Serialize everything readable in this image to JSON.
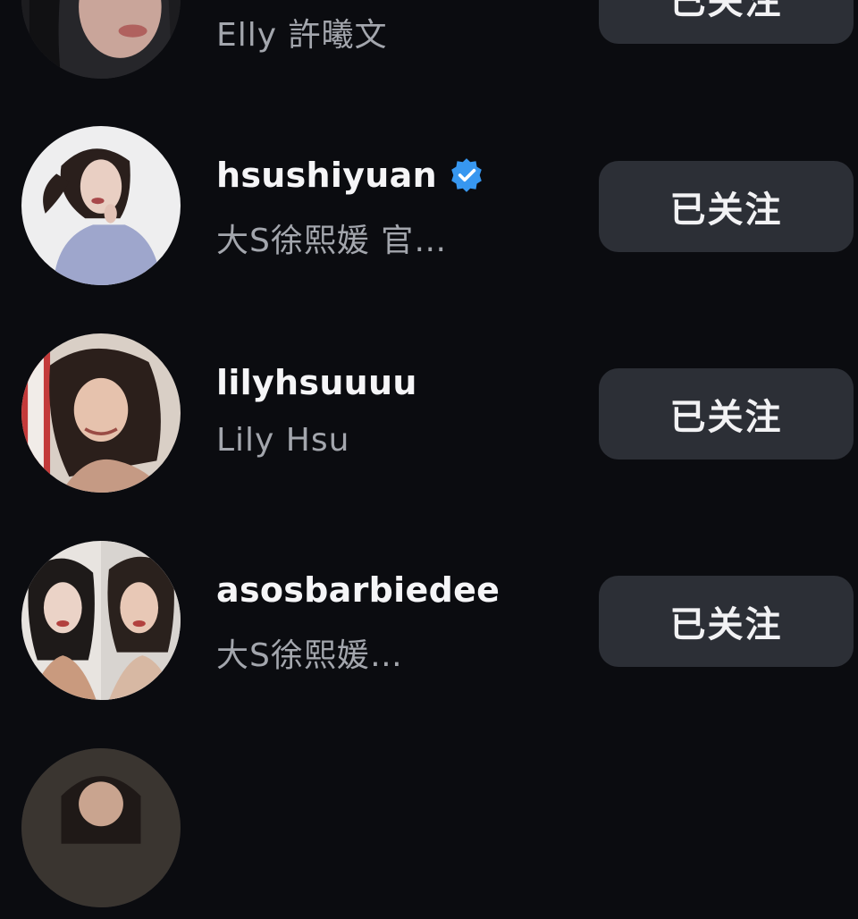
{
  "follow_list": {
    "rows": [
      {
        "username": "",
        "full_name": "Elly 許曦文",
        "button_label": "已关注"
      },
      {
        "username": "hsushiyuan",
        "verified": true,
        "full_name": "大S徐熙媛  官…",
        "button_label": "已关注"
      },
      {
        "username": "lilyhsuuuu",
        "full_name": "Lily Hsu",
        "button_label": "已关注"
      },
      {
        "username": "asosbarbiedee",
        "full_name": "大S徐熙媛…",
        "button_label": "已关注"
      },
      {
        "username": "",
        "full_name": "",
        "button_label": ""
      }
    ]
  },
  "colors": {
    "background": "#0b0c10",
    "button_bg": "#2c2f36",
    "verified_blue": "#3797f0",
    "secondary_text": "#a3a6ad"
  },
  "icons": {
    "verified": "verified-badge-icon"
  }
}
